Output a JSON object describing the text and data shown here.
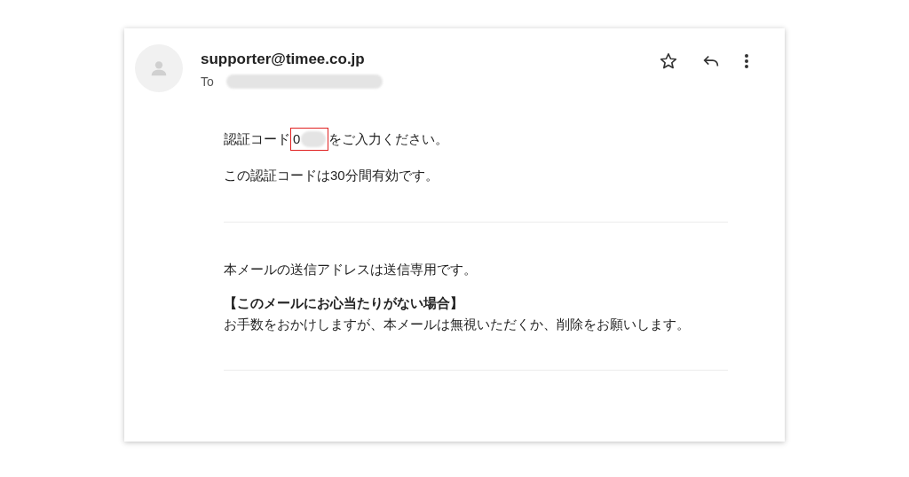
{
  "header": {
    "sender": "supporter@timee.co.jp",
    "to_label": "To"
  },
  "code_section": {
    "before": "認証コード",
    "code": "0",
    "after": "をご入力ください。",
    "validity": "この認証コードは30分間有効です。"
  },
  "notice_section": {
    "sender_note": "本メールの送信アドレスは送信専用です。",
    "heading": "【このメールにお心当たりがない場合】",
    "body": "お手数をおかけしますが、本メールは無視いただくか、削除をお願いします。"
  }
}
